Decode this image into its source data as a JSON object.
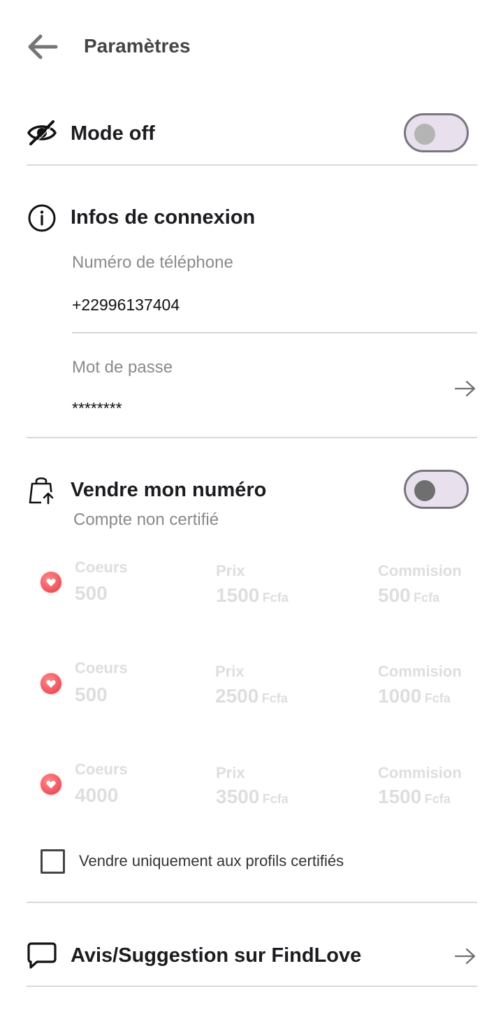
{
  "header": {
    "title": "Paramètres",
    "back_icon": "arrow-left-icon"
  },
  "mode_off": {
    "title": "Mode off",
    "icon": "eye-off-icon",
    "enabled": false
  },
  "login_info": {
    "title": "Infos de connexion",
    "icon": "info-icon",
    "phone_label": "Numéro de téléphone",
    "phone_value": "+22996137404",
    "password_label": "Mot de passe",
    "password_value": "********"
  },
  "sell_number": {
    "title": "Vendre mon numéro",
    "icon": "shopping-bag-upload-icon",
    "subtitle": "Compte non certifié",
    "enabled": false,
    "packages": [
      {
        "hearts_label": "Coeurs",
        "hearts": "500",
        "price_label": "Prix",
        "price": "1500",
        "price_unit": "Fcfa",
        "commission_label": "Commision",
        "commission": "500",
        "commission_unit": "Fcfa"
      },
      {
        "hearts_label": "Coeurs",
        "hearts": "500",
        "price_label": "Prix",
        "price": "2500",
        "price_unit": "Fcfa",
        "commission_label": "Commision",
        "commission": "1000",
        "commission_unit": "Fcfa"
      },
      {
        "hearts_label": "Coeurs",
        "hearts": "4000",
        "price_label": "Prix",
        "price": "3500",
        "price_unit": "Fcfa",
        "commission_label": "Commision",
        "commission": "1500",
        "commission_unit": "Fcfa"
      }
    ],
    "certified_only_label": "Vendre uniquement aux profils certifiés",
    "certified_only_checked": false
  },
  "feedback": {
    "title": "Avis/Suggestion sur FindLove",
    "icon": "chat-bubble-icon"
  },
  "colors": {
    "accent_red": "#e53946",
    "toggle_track": "#e8e0ec",
    "toggle_border": "#79747e"
  }
}
